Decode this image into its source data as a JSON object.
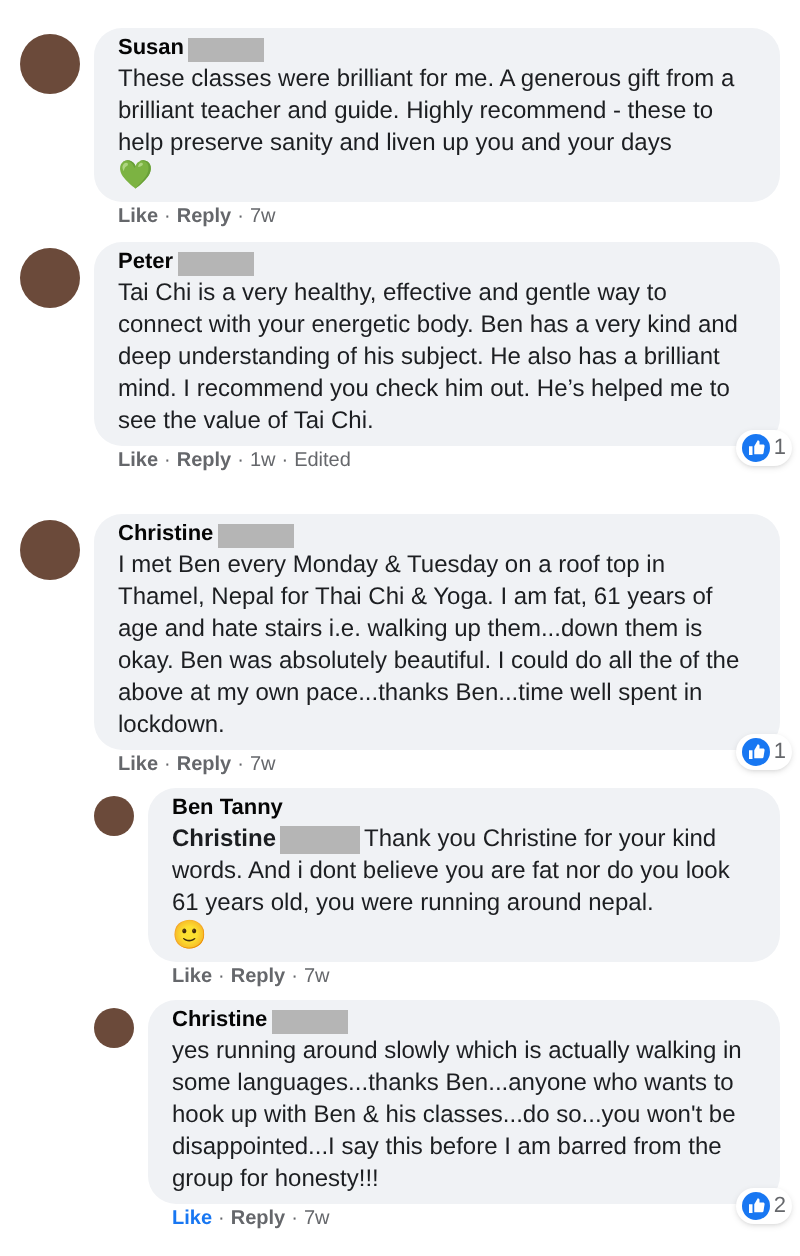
{
  "separator": "·",
  "comments": [
    {
      "author": "Susan",
      "text": "These classes were brilliant for me. A generous gift from a brilliant teacher and guide. Highly recommend - these to help preserve sanity and liven up you and your days",
      "emoji": "💚",
      "actions": [
        "Like",
        "Reply"
      ],
      "time": "7w",
      "liked": false
    },
    {
      "author": "Peter",
      "text": "Tai Chi is a very healthy, effective and gentle way to connect with your energetic body. Ben has a very kind and deep understanding of his subject. He also has a brilliant mind. I recommend you check him out. He’s helped me to see the value of Tai Chi.",
      "actions": [
        "Like",
        "Reply"
      ],
      "time": "1w",
      "edited": "Edited",
      "reactions": "1",
      "liked": false
    },
    {
      "author": "Christine",
      "text": "I met Ben every Monday & Tuesday on a roof top in Thamel, Nepal for Thai Chi & Yoga. I am fat, 61 years of age and hate stairs i.e. walking up them...down them is okay. Ben was absolutely beautiful. I could do all the of the above at my own pace...thanks Ben...time well spent in lockdown.",
      "actions": [
        "Like",
        "Reply"
      ],
      "time": "7w",
      "reactions": "1",
      "liked": false,
      "children": [
        {
          "author": "Ben Tanny",
          "tag": "Christine",
          "text": "Thank you Christine for your kind words. And i dont believe you are fat nor do you look 61 years old, you were running around nepal.",
          "emoji": "🙂",
          "actions": [
            "Like",
            "Reply"
          ],
          "time": "7w",
          "liked": false
        },
        {
          "author": "Christine",
          "text": "yes running around slowly which is actually walking in some languages...thanks Ben...anyone who wants to hook up with Ben & his classes...do so...you won't be disappointed...I say this before I am barred from the group for honesty!!!",
          "actions": [
            "Like",
            "Reply"
          ],
          "time": "7w",
          "reactions": "2",
          "liked": true
        }
      ]
    }
  ]
}
